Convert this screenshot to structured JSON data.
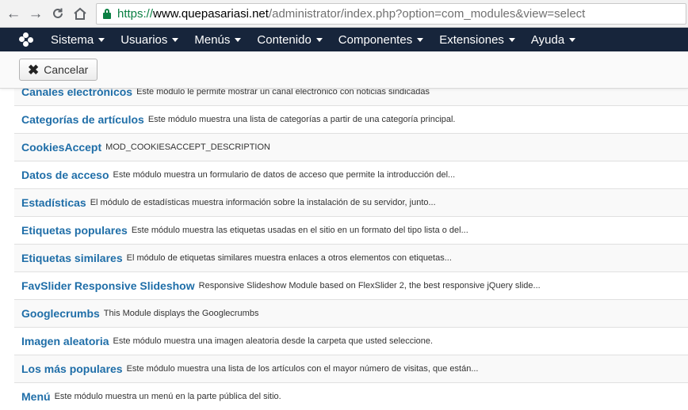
{
  "browser": {
    "url_scheme": "https://",
    "url_host": "www.quepasariasi.net",
    "url_path": "/administrator/index.php?option=com_modules&view=select"
  },
  "menu": [
    {
      "label": "Sistema",
      "key": "sistema"
    },
    {
      "label": "Usuarios",
      "key": "usuarios"
    },
    {
      "label": "Menús",
      "key": "menus"
    },
    {
      "label": "Contenido",
      "key": "contenido"
    },
    {
      "label": "Componentes",
      "key": "componentes"
    },
    {
      "label": "Extensiones",
      "key": "extensiones"
    },
    {
      "label": "Ayuda",
      "key": "ayuda"
    }
  ],
  "toolbar": {
    "cancel_label": "Cancelar"
  },
  "modules": [
    {
      "name": "Canales electrónicos",
      "desc": "Este módulo le permite mostrar un canal electrónico con noticias sindicadas"
    },
    {
      "name": "Categorías de artículos",
      "desc": "Este módulo muestra una lista de categorías a partir de una categoría principal."
    },
    {
      "name": "CookiesAccept",
      "desc": "MOD_COOKIESACCEPT_DESCRIPTION"
    },
    {
      "name": "Datos de acceso",
      "desc": "Este módulo muestra un formulario de datos de acceso que permite la introducción del..."
    },
    {
      "name": "Estadísticas",
      "desc": "El módulo de estadísticas muestra información sobre la instalación de su servidor, junto..."
    },
    {
      "name": "Etiquetas populares",
      "desc": "Este módulo muestra las etiquetas usadas en el sitio en un formato del tipo lista o del..."
    },
    {
      "name": "Etiquetas similares",
      "desc": "El módulo de etiquetas similares muestra enlaces a otros elementos con etiquetas..."
    },
    {
      "name": "FavSlider Responsive Slideshow",
      "desc": "Responsive Slideshow Module based on FlexSlider 2, the best responsive jQuery slide..."
    },
    {
      "name": "Googlecrumbs",
      "desc": "This Module displays the Googlecrumbs"
    },
    {
      "name": "Imagen aleatoria",
      "desc": "Este módulo muestra una imagen aleatoria desde la carpeta que usted seleccione."
    },
    {
      "name": "Los más populares",
      "desc": "Este módulo muestra una lista de los artículos con el mayor número de visitas, que están..."
    },
    {
      "name": "Menú",
      "desc": "Este módulo muestra un menú en la parte pública del sitio."
    }
  ]
}
